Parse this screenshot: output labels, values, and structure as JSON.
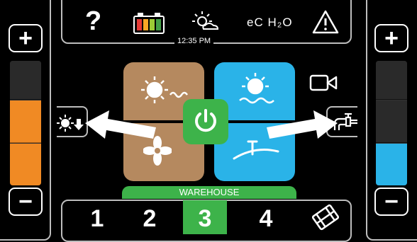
{
  "status": {
    "help": "?",
    "time": "12:35 PM",
    "eco_label": "eC H₂O",
    "battery_colors": [
      "#e53935",
      "#f9a825",
      "#9ccc35",
      "#43a047"
    ]
  },
  "tiles": {
    "heat_color": "#b5895f",
    "cool_color": "#2ab3e8",
    "power_color": "#3db34a"
  },
  "bars": {
    "left_color": "#f08a24",
    "right_color": "#2ab3e8"
  },
  "zone_label": "WAREHOUSE",
  "tabs": [
    "1",
    "2",
    "3",
    "4"
  ],
  "active_tab": 2,
  "icons": {
    "plus": "+",
    "minus": "−"
  }
}
